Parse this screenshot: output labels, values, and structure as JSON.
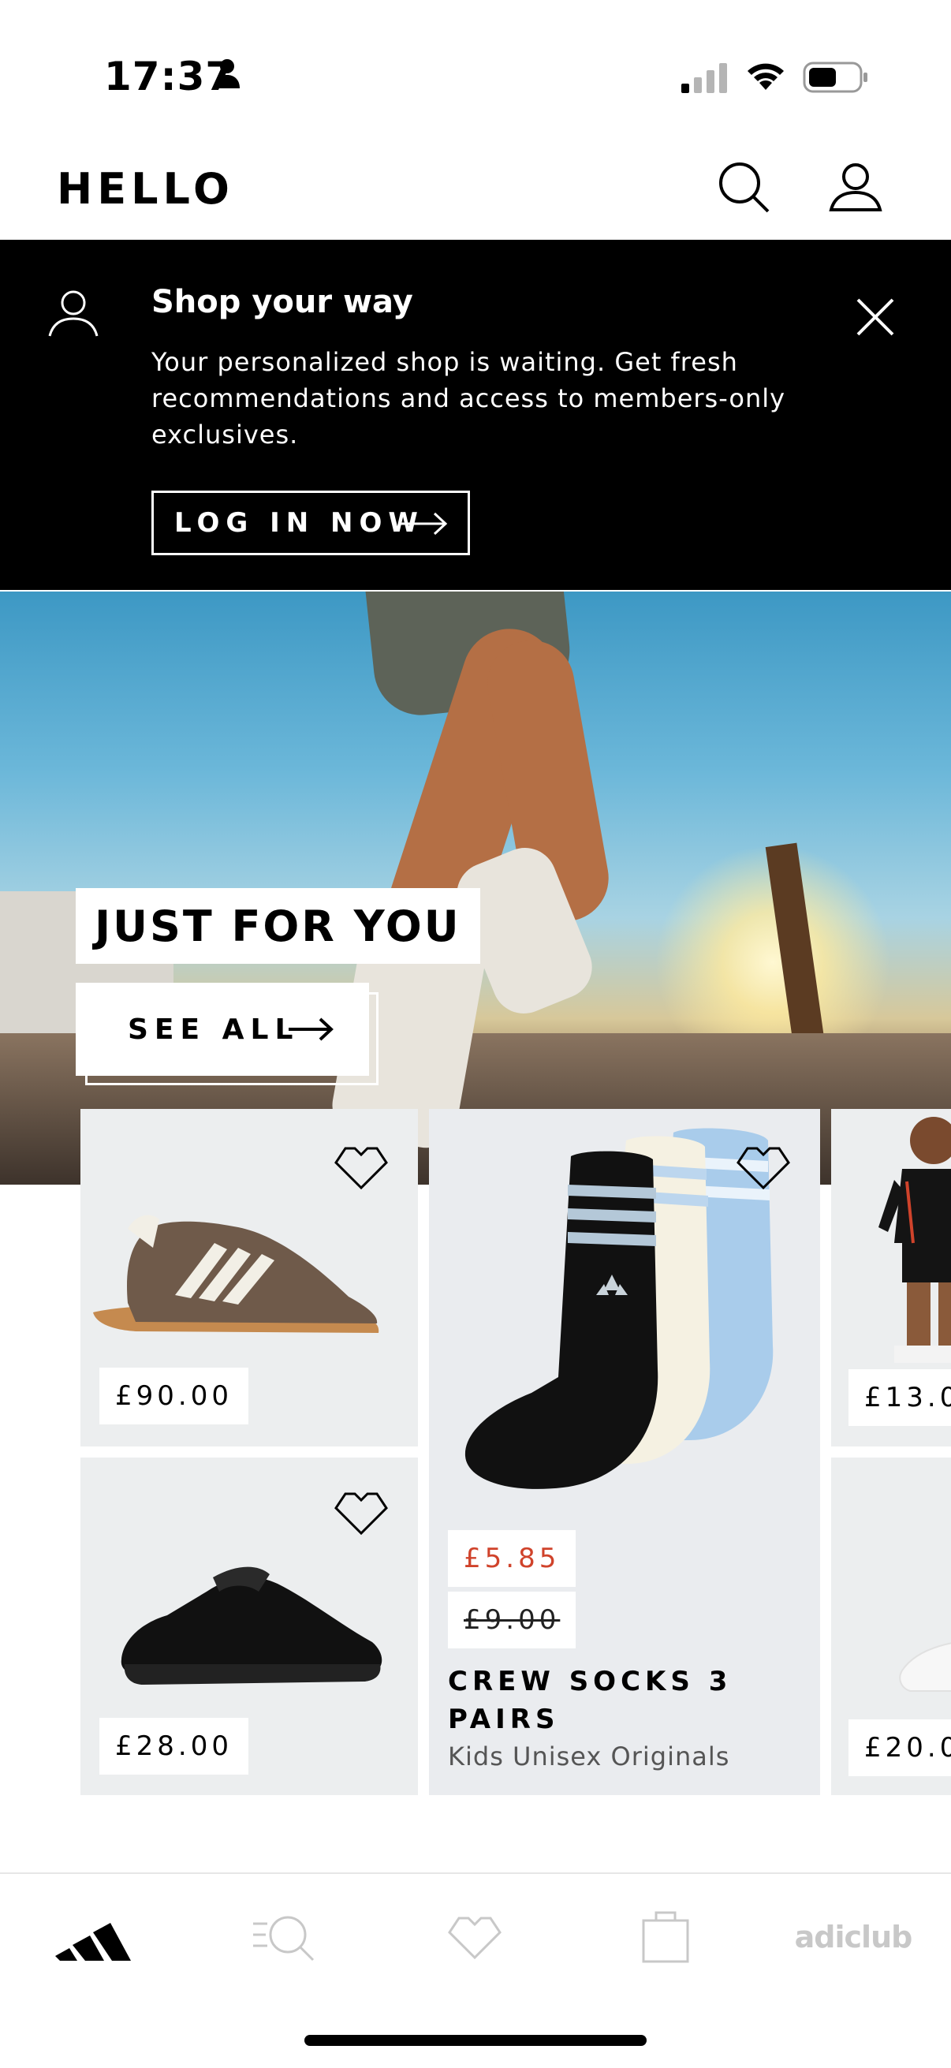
{
  "status_bar": {
    "time": "17:37"
  },
  "header": {
    "title": "HELLO"
  },
  "banner": {
    "title": "Shop your way",
    "text": "Your personalized shop is waiting. Get fresh recommendations and access to members-only exclusives.",
    "button_label": "LOG IN NOW"
  },
  "hero": {
    "label": "JUST FOR YOU",
    "button_label": "SEE ALL"
  },
  "products": [
    {
      "price": "£90.00"
    },
    {
      "price": "£28.00"
    },
    {
      "sale_price": "£5.85",
      "original_price": "£9.00",
      "title": "CREW SOCKS 3 PAIRS",
      "subtitle": "Kids Unisex Originals"
    },
    {
      "price": "£13.0"
    },
    {
      "price": "£20.0"
    }
  ],
  "bottom_nav": {
    "club_label": "adiclub"
  },
  "colors": {
    "sale": "#d0432b",
    "banner_bg": "#000000",
    "card_bg": "#eceeef"
  }
}
